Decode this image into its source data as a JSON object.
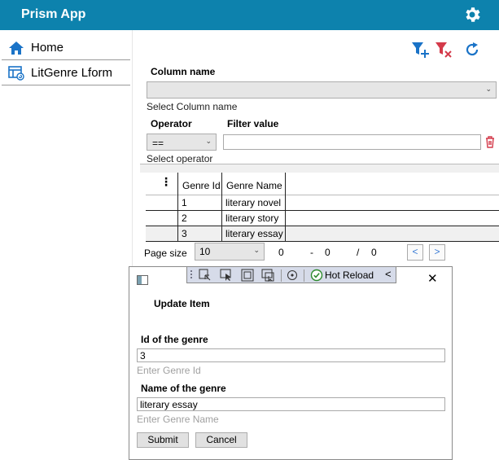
{
  "app": {
    "title": "Prism App",
    "settings_icon": "gear-icon"
  },
  "sidebar": {
    "items": [
      {
        "label": "Home",
        "icon": "home-icon"
      },
      {
        "label": "LitGenre Lform",
        "icon": "form-icon"
      }
    ]
  },
  "toolbar": {
    "icons": [
      "add-filter-icon",
      "clear-filter-icon",
      "refresh-icon"
    ]
  },
  "filter": {
    "column_label": "Column name",
    "column_value": "",
    "column_hint": "Select Column name",
    "operator_label": "Operator",
    "operator_value": "==",
    "operator_hint": "Select operator",
    "value_label": "Filter value",
    "value_value": ""
  },
  "grid": {
    "columns": [
      "Genre Id",
      "Genre Name"
    ],
    "rows": [
      {
        "id": "1",
        "name": "literary novel"
      },
      {
        "id": "2",
        "name": "literary story"
      },
      {
        "id": "3",
        "name": "literary essay"
      }
    ]
  },
  "pager": {
    "page_size_label": "Page size",
    "page_size": "10",
    "from": "0",
    "dash": "-",
    "to": "0",
    "slash": "/",
    "total": "0",
    "prev": "<",
    "next": ">"
  },
  "dialog": {
    "title": "Update Item",
    "close": "✕",
    "id_label": "Id of the genre",
    "id_value": "3",
    "id_placeholder": "Enter Genre Id",
    "name_label": "Name of the genre",
    "name_value": "literary essay",
    "name_placeholder": "Enter Genre Name",
    "submit": "Submit",
    "cancel": "Cancel"
  },
  "hot_reload": {
    "label": "Hot Reload",
    "collapse": "<"
  },
  "colors": {
    "header": "#0d82ad",
    "accent_blue": "#1a73c7",
    "danger": "#d43a4a"
  }
}
